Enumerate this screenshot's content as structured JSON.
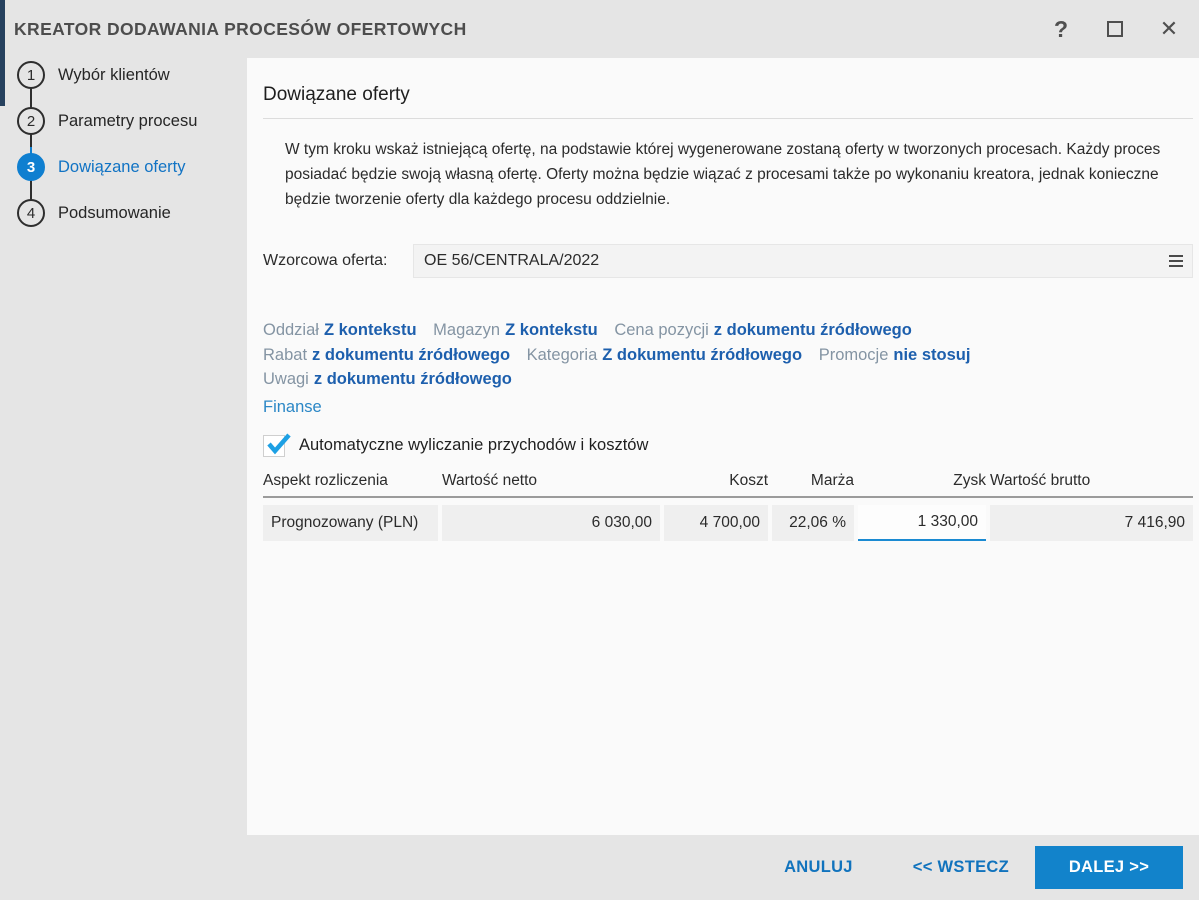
{
  "window": {
    "title": "KREATOR DODAWANIA PROCESÓW OFERTOWYCH",
    "help_icon": "?",
    "close_icon": "✕"
  },
  "steps": [
    {
      "number": "1",
      "label": "Wybór klientów"
    },
    {
      "number": "2",
      "label": "Parametry procesu"
    },
    {
      "number": "3",
      "label": "Dowiązane oferty"
    },
    {
      "number": "4",
      "label": "Podsumowanie"
    }
  ],
  "content": {
    "heading": "Dowiązane oferty",
    "description": "W tym kroku wskaż istniejącą ofertę, na podstawie której wygenerowane zostaną oferty w tworzonych procesach. Każdy proces posiadać będzie swoją własną ofertę. Oferty można będzie wiązać z procesami także po wykonaniu kreatora, jednak konieczne będzie tworzenie oferty dla każdego procesu oddzielnie.",
    "template_offer": {
      "label": "Wzorcowa oferta:",
      "value": "OE 56/CENTRALA/2022"
    },
    "settings_links": [
      {
        "label": "Oddział",
        "value": "Z kontekstu"
      },
      {
        "label": "Magazyn",
        "value": "Z kontekstu"
      },
      {
        "label": "Cena pozycji",
        "value": "z dokumentu źródłowego"
      },
      {
        "label": "Rabat",
        "value": "z dokumentu źródłowego"
      },
      {
        "label": "Kategoria",
        "value": "Z dokumentu źródłowego"
      },
      {
        "label": "Promocje",
        "value": "nie stosuj"
      },
      {
        "label": "Uwagi",
        "value": "z dokumentu źródłowego"
      }
    ],
    "finanse_link": "Finanse",
    "checkbox": {
      "label": "Automatyczne wyliczanie przychodów i kosztów",
      "checked": true
    },
    "finance_table": {
      "headers": [
        "Aspekt rozliczenia",
        "Wartość netto",
        "Koszt",
        "Marża",
        "Zysk",
        "Wartość brutto"
      ],
      "rows": [
        {
          "cells": [
            "Prognozowany (PLN)",
            "6 030,00",
            "4 700,00",
            "22,06 %",
            "1 330,00",
            "7 416,90"
          ]
        }
      ]
    }
  },
  "footer": {
    "cancel": "ANULUJ",
    "back": "<< WSTECZ",
    "next": "DALEJ >>"
  },
  "colors": {
    "accent_blue": "#1283cb",
    "active_step_blue": "#0f7fd0",
    "link_blue": "#1d5fad",
    "finanse_blue": "#2b87c6",
    "check_blue": "#1da0e4",
    "chrome_gray": "#e5e5e5"
  }
}
